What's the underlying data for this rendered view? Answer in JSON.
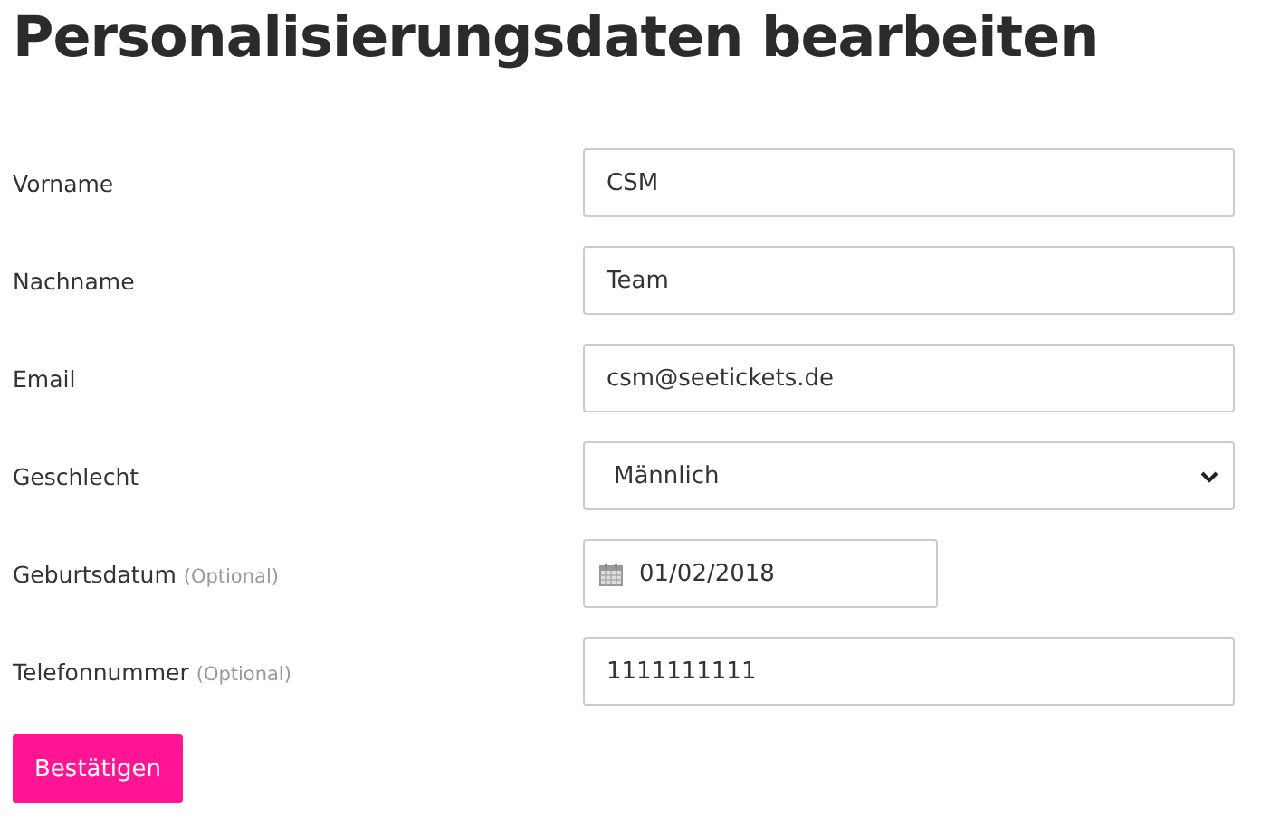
{
  "title": "Personalisierungsdaten bearbeiten",
  "fields": [
    {
      "label": "Vorname",
      "kind": "text",
      "value": "CSM"
    },
    {
      "label": "Nachname",
      "kind": "text",
      "value": "Team"
    },
    {
      "label": "Email",
      "kind": "text",
      "value": "csm@seetickets.de"
    },
    {
      "label": "Geschlecht",
      "kind": "select",
      "value": "Männlich"
    },
    {
      "label": "Geburtsdatum",
      "note": "(Optional)",
      "kind": "date",
      "value": "01/02/2018"
    },
    {
      "label": "Telefonnummer",
      "note": "(Optional)",
      "kind": "text",
      "value": "1111111111"
    }
  ],
  "submit": "Bestätigen"
}
